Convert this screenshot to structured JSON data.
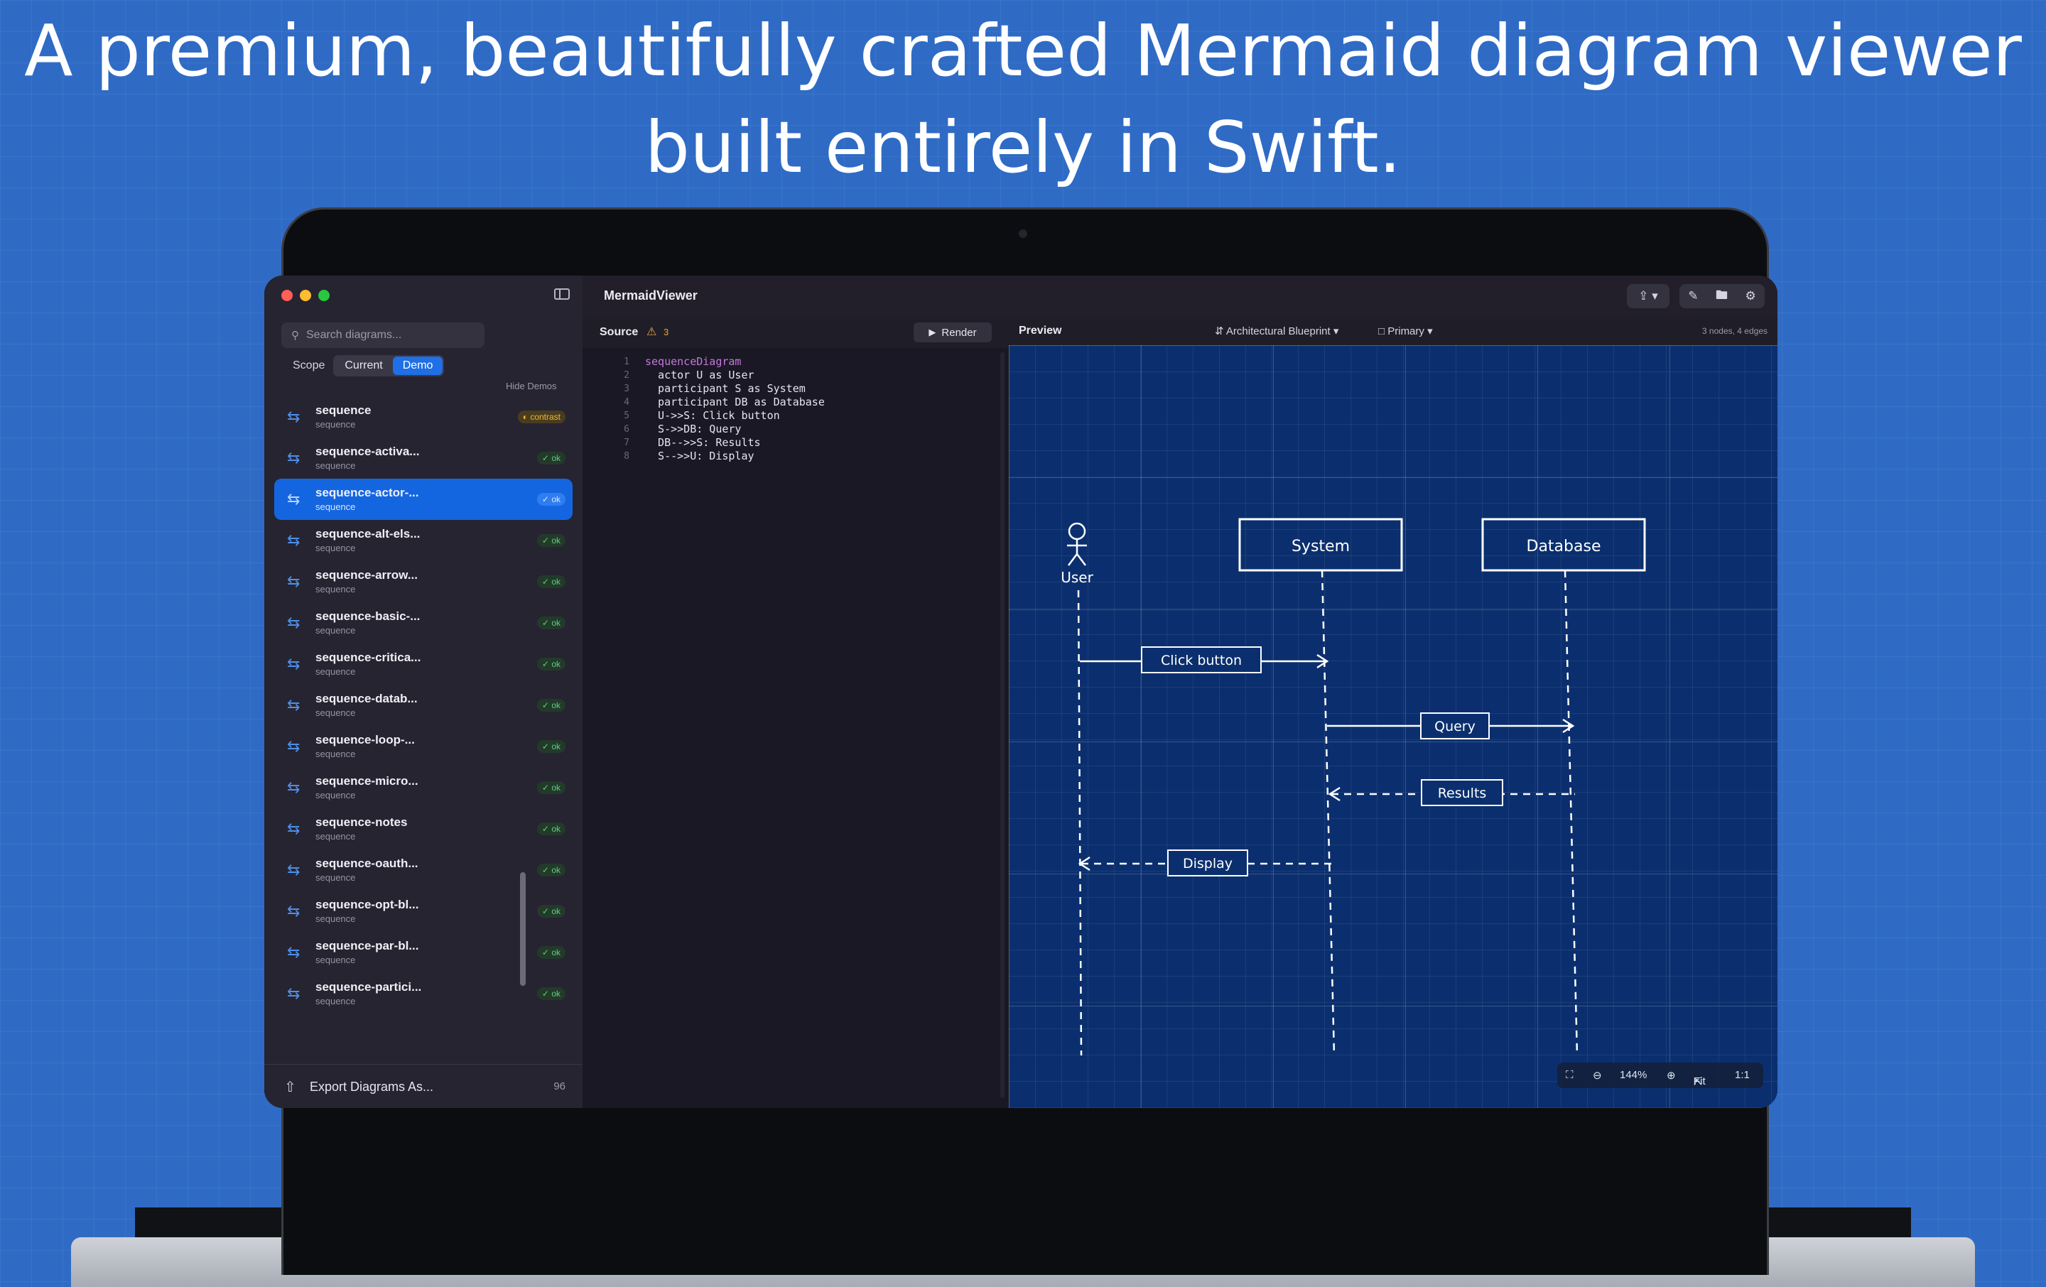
{
  "headline": {
    "line1": "A premium, beautifully crafted Mermaid diagram viewer",
    "line2": "built entirely in Swift."
  },
  "window": {
    "app_title": "MermaidViewer"
  },
  "sidebar": {
    "search_placeholder": "Search diagrams...",
    "scope_label": "Scope",
    "scope_options": [
      "Current",
      "Demo"
    ],
    "scope_selected": "Demo",
    "hide_demos": "Hide Demos",
    "items": [
      {
        "title": "sequence",
        "subtitle": "sequence",
        "badge": "contrast",
        "badge_type": "warn"
      },
      {
        "title": "sequence-activa...",
        "subtitle": "sequence",
        "badge": "ok",
        "badge_type": "ok"
      },
      {
        "title": "sequence-actor-...",
        "subtitle": "sequence",
        "badge": "ok",
        "badge_type": "ok",
        "selected": true
      },
      {
        "title": "sequence-alt-els...",
        "subtitle": "sequence",
        "badge": "ok",
        "badge_type": "ok"
      },
      {
        "title": "sequence-arrow...",
        "subtitle": "sequence",
        "badge": "ok",
        "badge_type": "ok"
      },
      {
        "title": "sequence-basic-...",
        "subtitle": "sequence",
        "badge": "ok",
        "badge_type": "ok"
      },
      {
        "title": "sequence-critica...",
        "subtitle": "sequence",
        "badge": "ok",
        "badge_type": "ok"
      },
      {
        "title": "sequence-datab...",
        "subtitle": "sequence",
        "badge": "ok",
        "badge_type": "ok"
      },
      {
        "title": "sequence-loop-...",
        "subtitle": "sequence",
        "badge": "ok",
        "badge_type": "ok"
      },
      {
        "title": "sequence-micro...",
        "subtitle": "sequence",
        "badge": "ok",
        "badge_type": "ok"
      },
      {
        "title": "sequence-notes",
        "subtitle": "sequence",
        "badge": "ok",
        "badge_type": "ok"
      },
      {
        "title": "sequence-oauth...",
        "subtitle": "sequence",
        "badge": "ok",
        "badge_type": "ok"
      },
      {
        "title": "sequence-opt-bl...",
        "subtitle": "sequence",
        "badge": "ok",
        "badge_type": "ok"
      },
      {
        "title": "sequence-par-bl...",
        "subtitle": "sequence",
        "badge": "ok",
        "badge_type": "ok"
      },
      {
        "title": "sequence-partici...",
        "subtitle": "sequence",
        "badge": "ok",
        "badge_type": "ok"
      }
    ],
    "export_label": "Export Diagrams As...",
    "export_count": "96"
  },
  "source": {
    "label": "Source",
    "warning_count": "3",
    "render_label": "Render",
    "line_numbers": [
      "1",
      "2",
      "3",
      "4",
      "5",
      "6",
      "7",
      "8"
    ],
    "lines": [
      "sequenceDiagram",
      "  actor U as User",
      "  participant S as System",
      "  participant DB as Database",
      "  U->>S: Click button",
      "  S->>DB: Query",
      "  DB-->>S: Results",
      "  S-->>U: Display"
    ]
  },
  "preview": {
    "label": "Preview",
    "theme": "Architectural Blueprint",
    "variant": "Primary",
    "stats": "3 nodes, 4 edges",
    "zoom": "144%",
    "fit_label": "Fit",
    "one_to_one": "1:1"
  },
  "diagram": {
    "actor": "User",
    "participants": [
      "System",
      "Database"
    ],
    "messages": [
      {
        "label": "Click button",
        "dashed": false
      },
      {
        "label": "Query",
        "dashed": false
      },
      {
        "label": "Results",
        "dashed": true
      },
      {
        "label": "Display",
        "dashed": true
      }
    ]
  },
  "colors": {
    "accent": "#1f6fe6",
    "blueprint": "#0b2f6e",
    "ok": "#5fcf7a",
    "warn": "#e9b742"
  }
}
